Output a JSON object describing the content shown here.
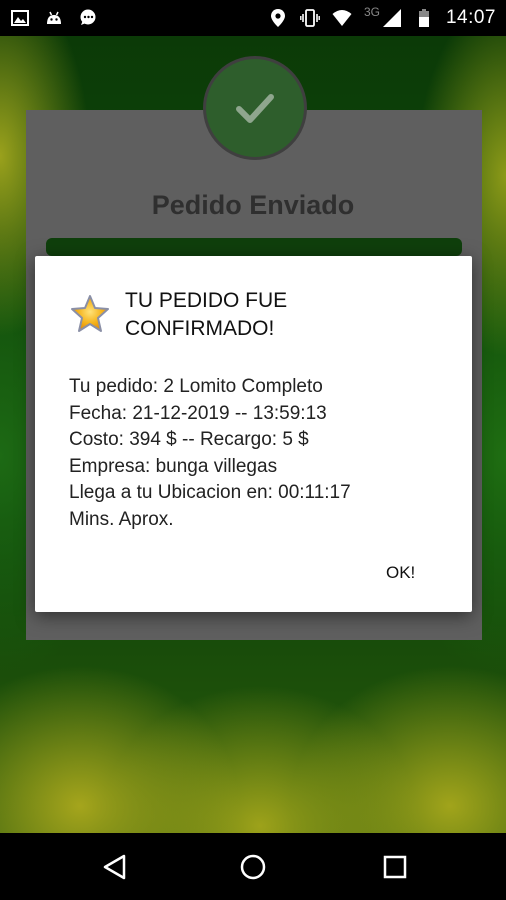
{
  "status_bar": {
    "network_label": "3G",
    "time": "14:07",
    "icons": [
      "image-icon",
      "android-icon",
      "chat-bubble-icon",
      "location-icon",
      "vibrate-icon",
      "wifi-icon",
      "signal-icon",
      "battery-icon"
    ]
  },
  "background_screen": {
    "title": "Pedido Enviado",
    "check_icon": "checkmark-icon",
    "accent_color": "#2e5e2c"
  },
  "dialog": {
    "icon": "star-icon",
    "title_line1": "TU PEDIDO FUE",
    "title_line2": "CONFIRMADO!",
    "body_lines": [
      "Tu pedido: 2 Lomito Completo",
      "Fecha: 21-12-2019 -- 13:59:13",
      "Costo: 394 $ -- Recargo: 5 $",
      "Empresa: bunga villegas",
      "Llega a tu Ubicacion en: 00:11:17",
      "Mins. Aprox."
    ],
    "ok_label": "OK!"
  },
  "nav_bar": {
    "icons": [
      "back-icon",
      "home-icon",
      "recents-icon"
    ]
  }
}
